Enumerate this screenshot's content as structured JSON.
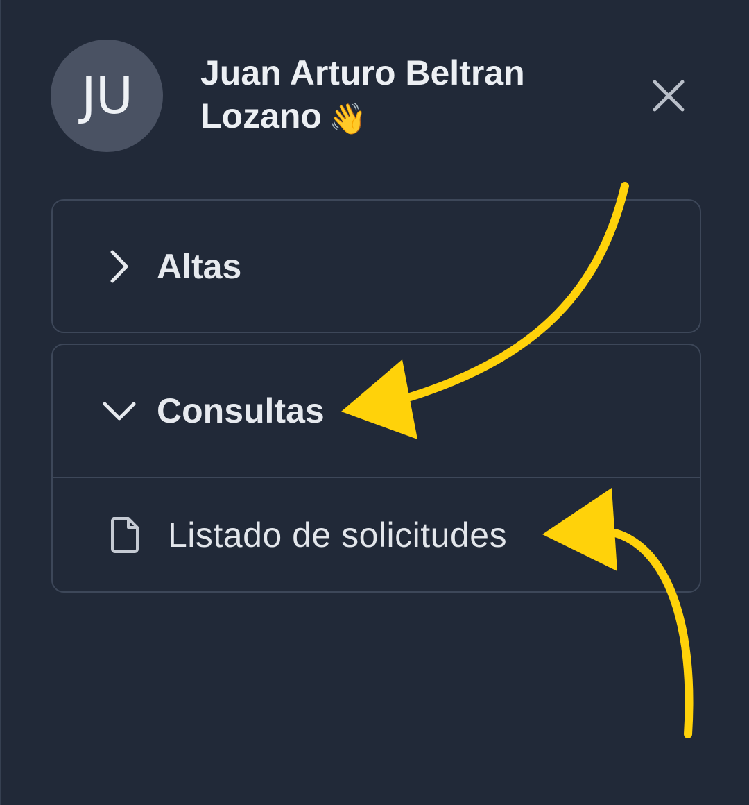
{
  "user": {
    "initials": "JU",
    "name_line1": "Juan Arturo Beltran",
    "name_line2": "Lozano",
    "greeting_emoji": "👋"
  },
  "close": {
    "icon": "close-icon"
  },
  "menu": {
    "sections": [
      {
        "label": "Altas",
        "state": "collapsed",
        "icon": "chevron-right-icon"
      },
      {
        "label": "Consultas",
        "state": "expanded",
        "icon": "chevron-down-icon",
        "items": [
          {
            "label": "Listado de solicitudes",
            "icon": "document-icon"
          }
        ]
      }
    ]
  },
  "colors": {
    "background": "#212938",
    "panel_border": "#3d4759",
    "avatar_bg": "#4a5263",
    "text": "#e6e9ee",
    "annotation_arrow": "#ffd20a"
  }
}
